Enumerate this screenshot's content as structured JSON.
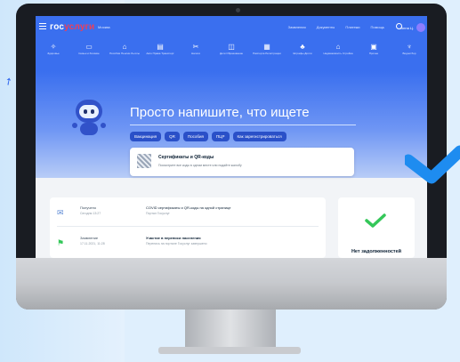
{
  "header": {
    "logo_first": "гос",
    "logo_second": "услуги",
    "city": "Москва",
    "links": [
      "Заявления",
      "Документы",
      "Платежи",
      "Помощь"
    ],
    "user_name": "Анна Ц."
  },
  "categories": [
    {
      "icon": "✧",
      "label": "Здоровье"
    },
    {
      "icon": "▭",
      "label": "Семья и близкие"
    },
    {
      "icon": "⌂",
      "label": "Пособия Пенсии Льготы"
    },
    {
      "icon": "▤",
      "label": "Авто Права Транспорт"
    },
    {
      "icon": "✂",
      "label": "Налоги"
    },
    {
      "icon": "◫",
      "label": "Дети Образование"
    },
    {
      "icon": "▦",
      "label": "Паспорта Регистрации"
    },
    {
      "icon": "♣",
      "label": "Штрафы Долги"
    },
    {
      "icon": "⌂",
      "label": "Недвижимость Стройка"
    },
    {
      "icon": "▣",
      "label": "Прочее"
    },
    {
      "icon": "♆",
      "label": "Водоотбор"
    }
  ],
  "hero": {
    "title": "Просто напишите, что ищете",
    "chips": [
      "Вакцинация",
      "QR",
      "Пособия",
      "ПЦР",
      "Как зарегистрироваться"
    ]
  },
  "cert": {
    "title": "Сертификаты и QR-коды",
    "subtitle": "Посмотрите все коды в одном месте или подайте жалобу"
  },
  "feed": [
    {
      "category": "Получено",
      "date": "Сегодня 13:27",
      "title": "COVID сертификаты и QR-коды на одной странице",
      "subtitle": "Портал Госуслуг"
    },
    {
      "category": "Заявление",
      "date": "17.11.2021, 11:28",
      "title": "Участие в переписи населения",
      "subtitle": "Перепись на портале Госуслуг завершено"
    }
  ],
  "debt": {
    "text": "Нет задолженностей"
  },
  "colors": {
    "primary": "#3a6fef",
    "accent_red": "#ee3f58",
    "success": "#34c759",
    "check_blue": "#1e8cf0"
  }
}
